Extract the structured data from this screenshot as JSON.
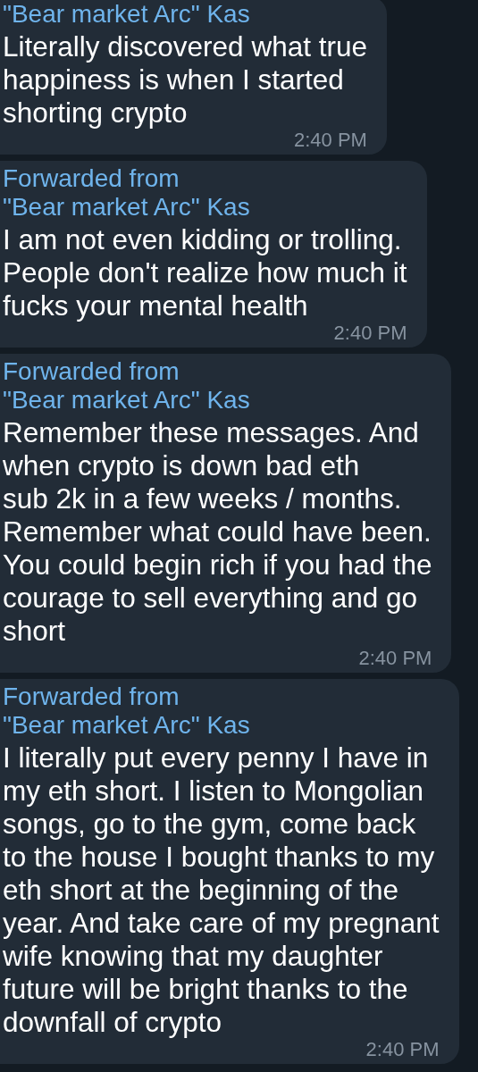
{
  "messages": [
    {
      "forwarded_from": "\"Bear market Arc\" Kas",
      "text": "Literally discovered what true\nhappiness is when I started\nshorting crypto",
      "time": "2:40 PM"
    },
    {
      "forwarded_label": "Forwarded from",
      "forwarded_from": "\"Bear market Arc\" Kas",
      "text": "I am not even kidding or trolling.\nPeople don't realize how much it\nfucks your mental health",
      "time": "2:40 PM"
    },
    {
      "forwarded_label": "Forwarded from",
      "forwarded_from": "\"Bear market Arc\" Kas",
      "text": "Remember these messages. And\nwhen crypto is down bad eth\nsub 2k in a few weeks / months.\nRemember what could have been.\nYou could begin rich if you had the\ncourage to sell everything and go\nshort",
      "time": "2:40 PM"
    },
    {
      "forwarded_label": "Forwarded from",
      "forwarded_from": "\"Bear market Arc\" Kas",
      "text": "I literally put every penny I have in\nmy eth short. I listen to Mongolian\nsongs, go to the gym, come back\nto the house I bought thanks to my\neth short at the beginning of the\nyear. And take care of my pregnant\nwife knowing that my daughter\nfuture will be bright thanks to the\ndownfall of crypto",
      "time": "2:40 PM"
    }
  ]
}
